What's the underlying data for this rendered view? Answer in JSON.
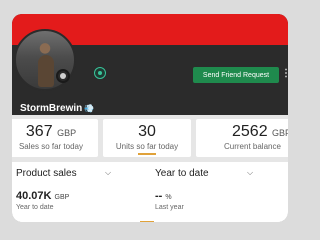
{
  "colors": {
    "banner": "#e31b1b",
    "primary_button": "#1f8a4d",
    "accent": "#e0a23a",
    "dark_panel": "#2b2b2b"
  },
  "profile": {
    "username": "StormBrewin",
    "username_badge_icon": "dust-emoji-icon",
    "friend_button_label": "Send Friend Request"
  },
  "stats": [
    {
      "value": "367",
      "unit": "GBP",
      "label": "Sales so far today"
    },
    {
      "value": "30",
      "unit": "",
      "label": "Units so far today"
    },
    {
      "value": "2562",
      "unit": "GBP",
      "label": "Current balance"
    }
  ],
  "sales": {
    "metric_select": "Product sales",
    "period_select": "Year to date",
    "primary": {
      "value": "40.07K",
      "unit": "GBP",
      "caption": "Year to date"
    },
    "comparison": {
      "value": "--",
      "unit": "%",
      "caption": "Last year"
    }
  }
}
